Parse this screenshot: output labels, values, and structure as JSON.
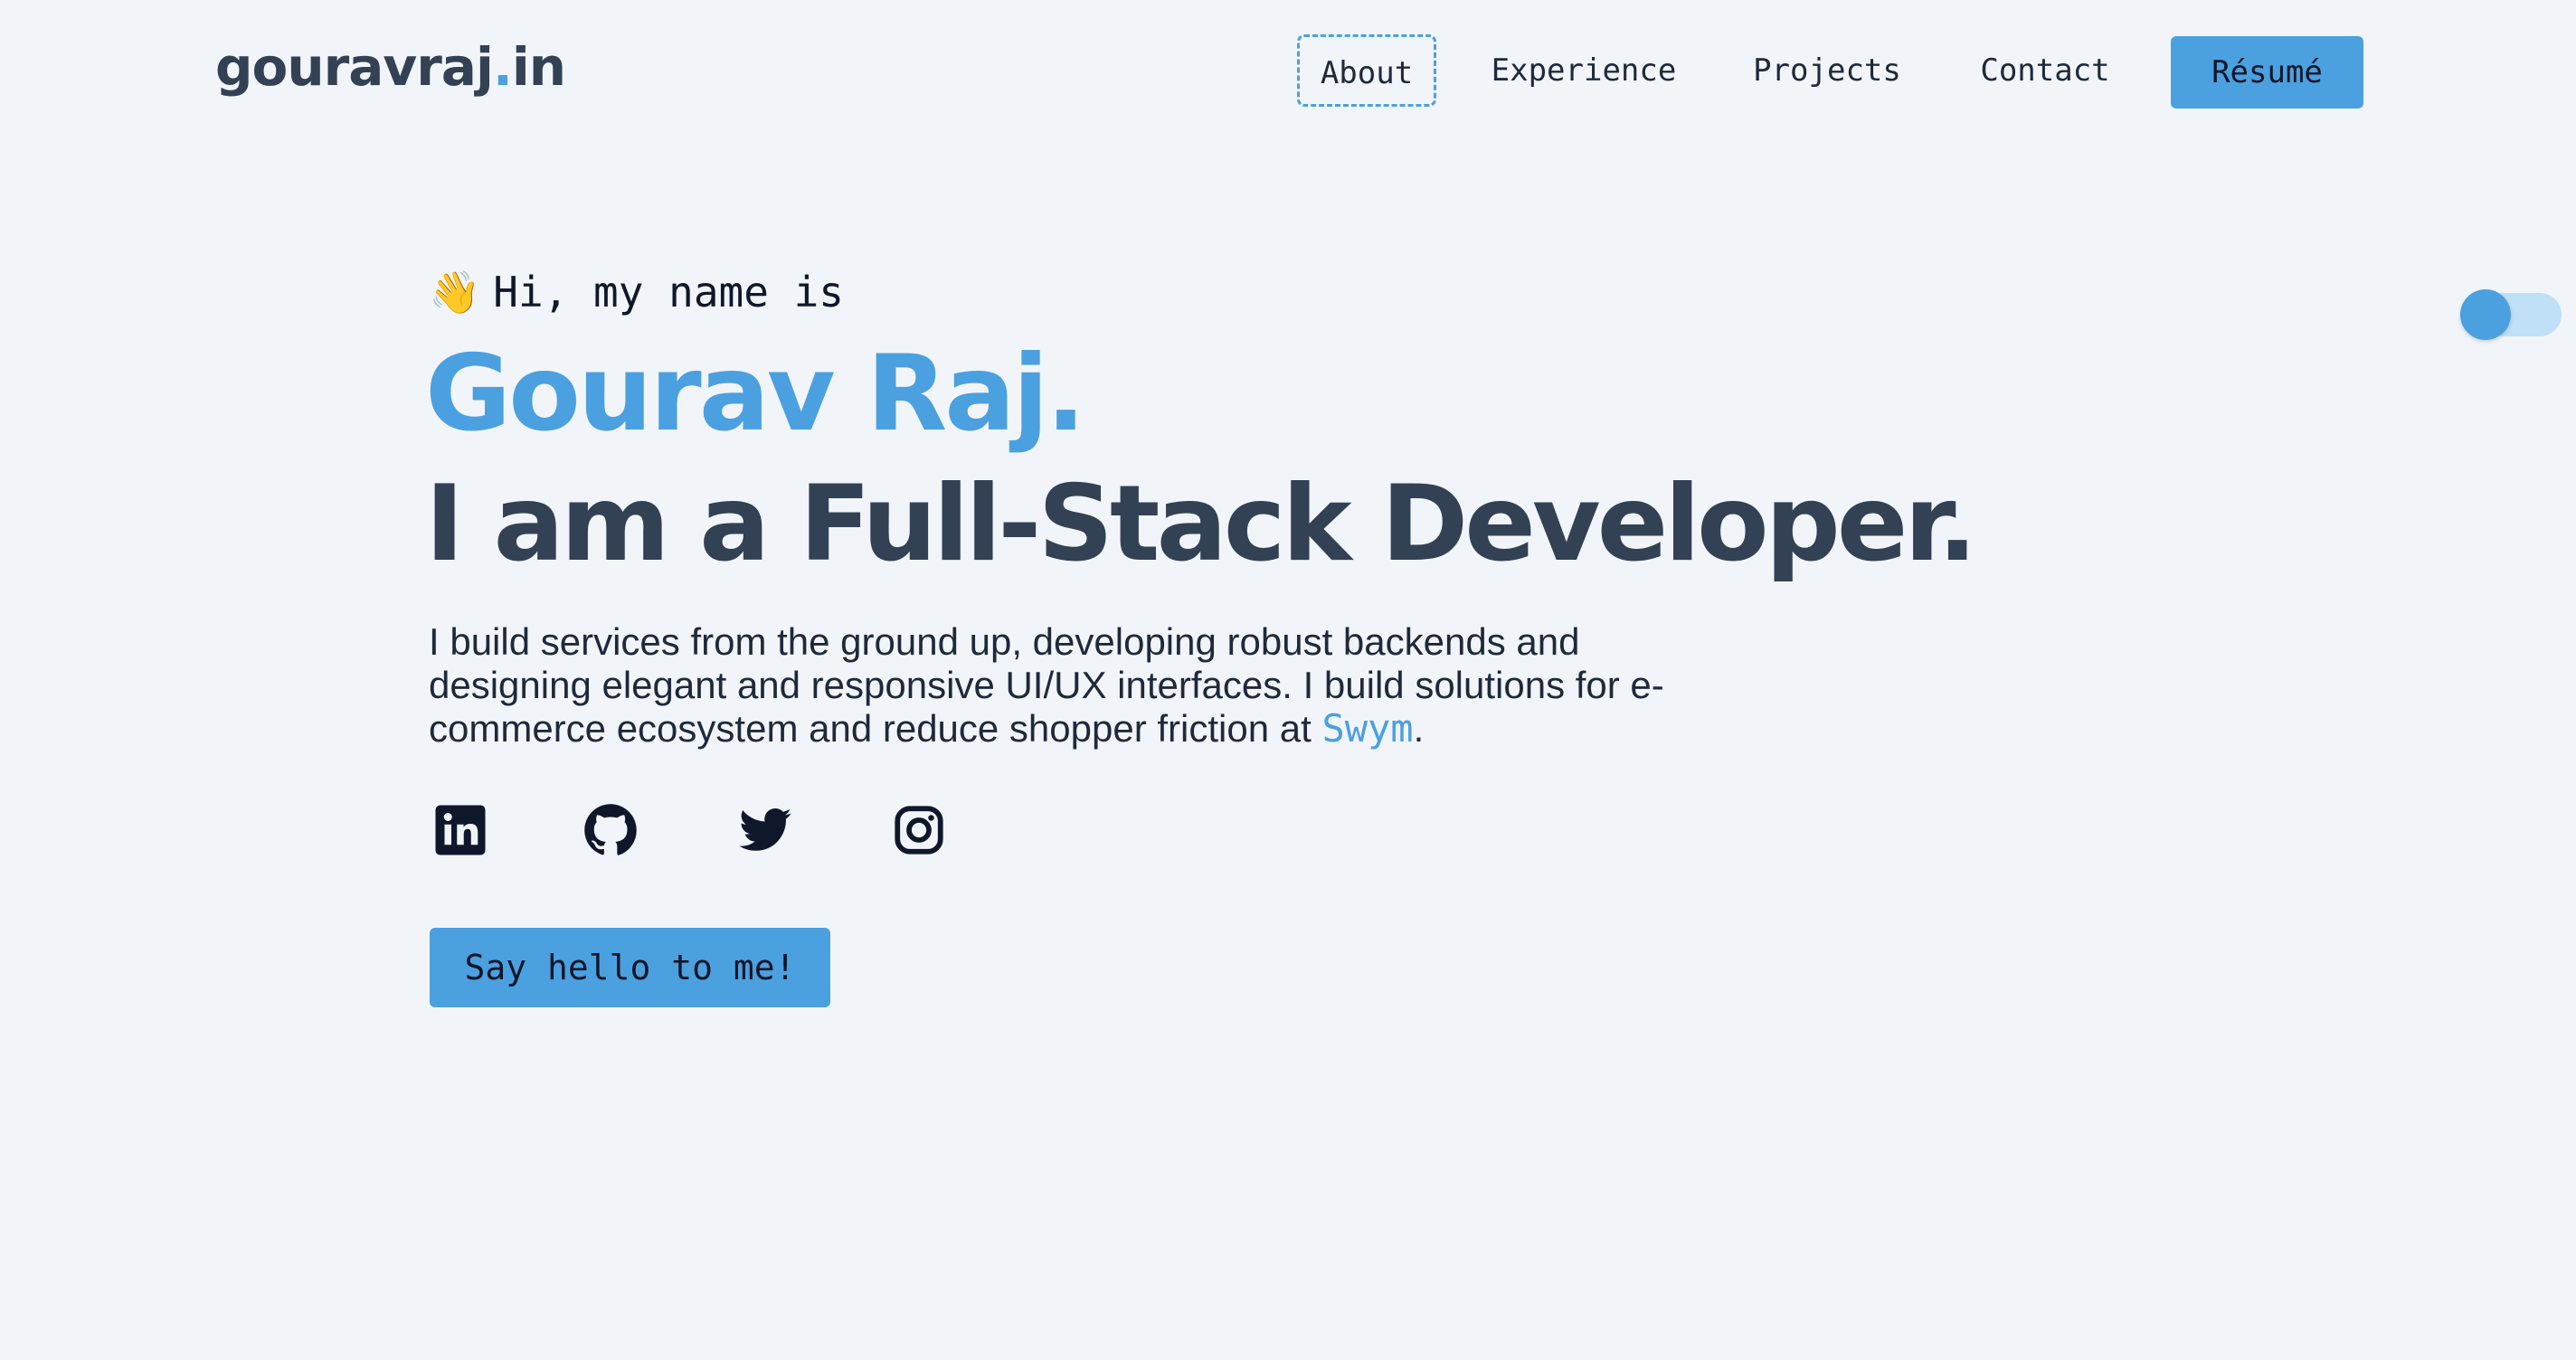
{
  "header": {
    "logo_main": "gouravraj",
    "logo_dot": ".",
    "logo_tld": "in",
    "nav": [
      "About",
      "Experience",
      "Projects",
      "Contact"
    ],
    "resume_label": "Résumé"
  },
  "hero": {
    "greeting_emoji": "👋",
    "greeting": "Hi, my name is",
    "name": "Gourav Raj.",
    "role": "I am a Full-Stack Developer.",
    "bio_before": "I build services from the ground up, developing robust backends and designing elegant and responsive UI/UX interfaces. I build solutions for e-commerce ecosystem and reduce shopper friction at ",
    "bio_company": "Swym",
    "bio_after": ".",
    "cta_label": "Say hello to me!"
  },
  "social_icons": [
    "linkedin-icon",
    "github-icon",
    "twitter-icon",
    "instagram-icon"
  ],
  "theme_toggle": {
    "state": "on"
  },
  "colors": {
    "background": "#f1f5f9",
    "accent": "#4ba0e0",
    "heading": "#334155",
    "text": "#0f172a"
  }
}
